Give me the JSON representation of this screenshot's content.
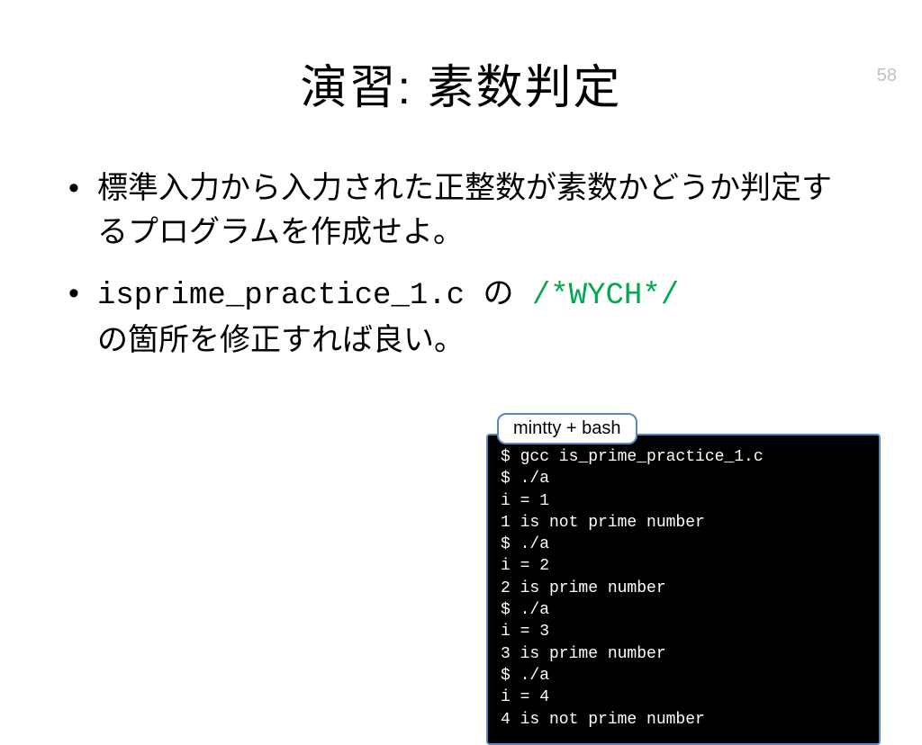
{
  "page_number": "58",
  "title": "演習: 素数判定",
  "bullets": {
    "b1": "標準入力から入力された正整数が素数かどうか判定するプログラムを作成せよ。",
    "b2_part1": "isprime_practice_1.c の ",
    "b2_comment": "/*WYCH*/",
    "b2_part2": "の箇所を修正すれば良い。"
  },
  "terminal": {
    "label": "mintty + bash",
    "lines": "$ gcc is_prime_practice_1.c\n$ ./a\ni = 1\n1 is not prime number\n$ ./a\ni = 2\n2 is prime number\n$ ./a\ni = 3\n3 is prime number\n$ ./a\ni = 4\n4 is not prime number"
  }
}
